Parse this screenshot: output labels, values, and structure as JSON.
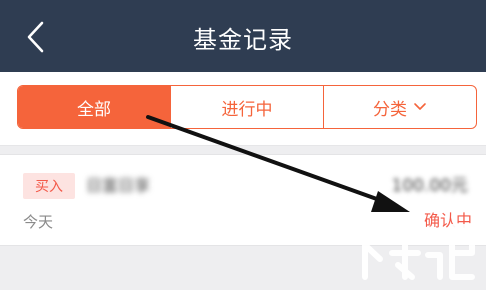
{
  "header": {
    "title": "基金记录",
    "back_icon": "chevron-left-icon"
  },
  "tabs": [
    {
      "label": "全部",
      "active": true
    },
    {
      "label": "进行中",
      "active": false
    },
    {
      "label": "分类",
      "active": false,
      "icon": "chevron-down-icon"
    }
  ],
  "record": {
    "badge": "买入",
    "fund_name": "日富日享",
    "amount": "100.00元",
    "date": "今天",
    "status": "确认中"
  },
  "colors": {
    "header_bg": "#2f3d52",
    "accent": "#f5643b",
    "status_red": "#f35a4a",
    "annotation_arrow": "#111111"
  },
  "watermark": {
    "icon": "xiazaiba-logo"
  }
}
